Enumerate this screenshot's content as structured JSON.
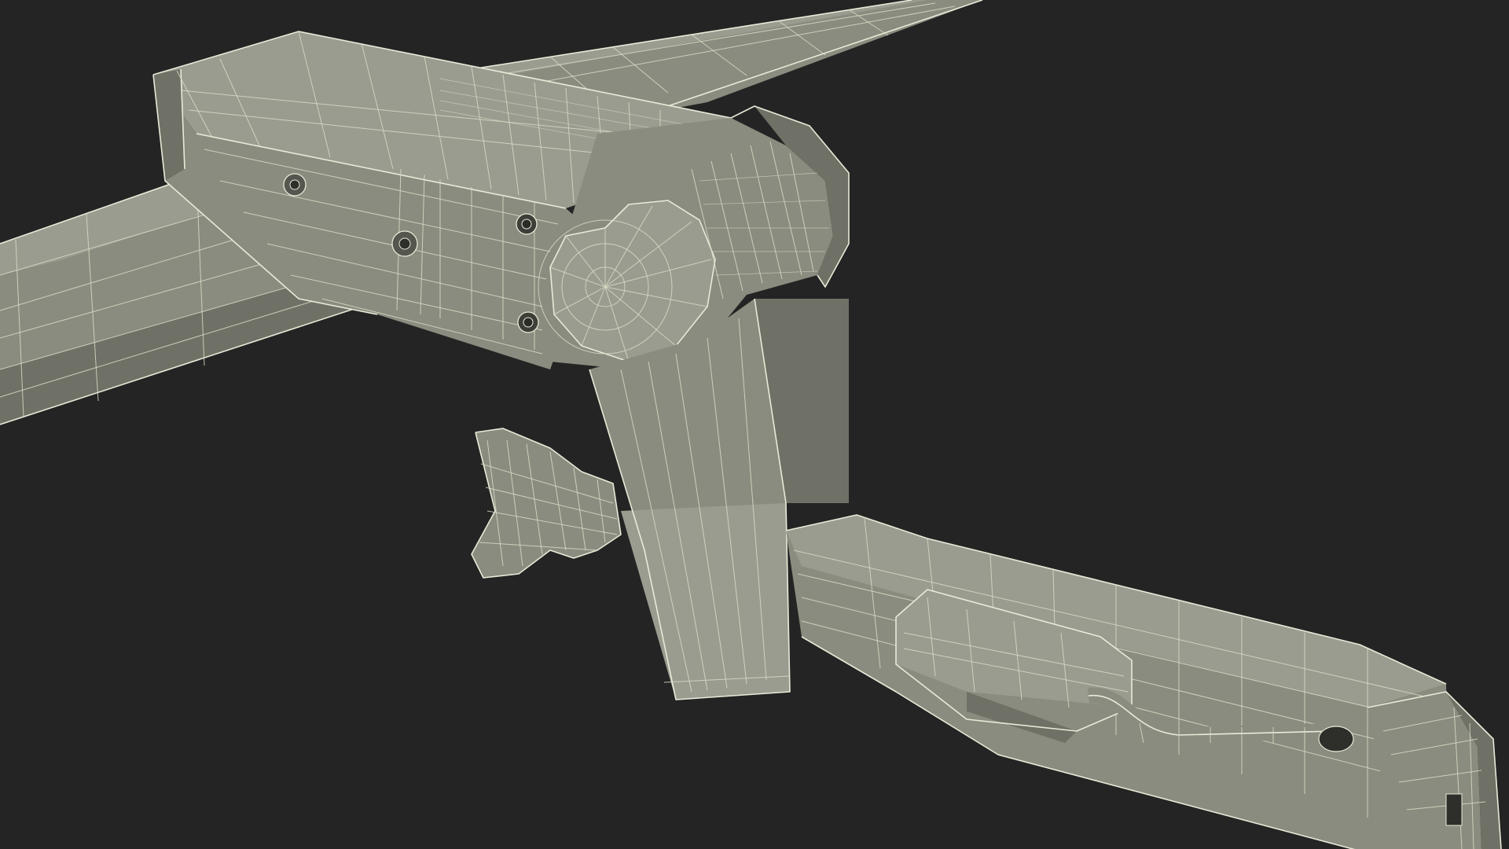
{
  "scene": {
    "subject": "wireframe-3d-model",
    "background_color": "#242424",
    "mesh_color": "#8a8c7f",
    "wire_color": "#e9ead8"
  }
}
